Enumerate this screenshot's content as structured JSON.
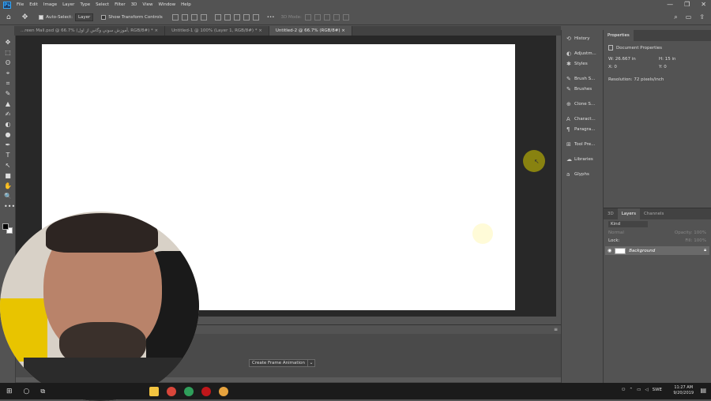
{
  "menubar": {
    "app_icon": "Ps",
    "items": [
      "File",
      "Edit",
      "Image",
      "Layer",
      "Type",
      "Select",
      "Filter",
      "3D",
      "View",
      "Window",
      "Help"
    ],
    "window_controls": [
      "—",
      "❐",
      "✕"
    ]
  },
  "options": {
    "move_tool": "✥",
    "auto_select_label": "Auto-Select:",
    "auto_select_value": "Layer",
    "show_transform_label": "Show Transform Controls",
    "mode_label": "3D Mode:",
    "more": "•••"
  },
  "tabs": [
    {
      "label": "...reen Mall.psd @ 66.7% (آموزش سوني وگاس از اول, RGB/8#) *",
      "close": "×"
    },
    {
      "label": "Untitled-1 @ 100% (Layer 1, RGB/8#) *",
      "close": "×"
    },
    {
      "label": "Untitled-2 @ 66.7% (RGB/8#)",
      "close": "×"
    }
  ],
  "tools": [
    "✥",
    "⬚",
    "ʘ",
    "⌖",
    "⌗",
    "✎",
    "▲",
    "✍",
    "◐",
    "●",
    "✒",
    "T",
    "↖",
    "■",
    "✋",
    "🔍",
    "•••"
  ],
  "timeline": {
    "create_frame": "Create Frame Animation",
    "dropdown": "⌄"
  },
  "dock": [
    {
      "icon": "⟲",
      "label": "History"
    },
    {
      "icon": "◐",
      "label": "Adjustm..."
    },
    {
      "icon": "✱",
      "label": "Styles"
    },
    {
      "icon": "✎",
      "label": "Brush S..."
    },
    {
      "icon": "✎",
      "label": "Brushes"
    },
    {
      "icon": "⊕",
      "label": "Clone S..."
    },
    {
      "icon": "A",
      "label": "Charact..."
    },
    {
      "icon": "¶",
      "label": "Paragra..."
    },
    {
      "icon": "⊞",
      "label": "Tool Pre..."
    },
    {
      "icon": "☁",
      "label": "Libraries"
    },
    {
      "icon": "a",
      "label": "Glyphs"
    }
  ],
  "properties": {
    "tab": "Properties",
    "title": "Document Properties",
    "w_label": "W:",
    "w_value": "26.667 in",
    "h_label": "H:",
    "h_value": "15 in",
    "x_label": "X:",
    "x_value": "0",
    "y_label": "Y:",
    "y_value": "0",
    "resolution": "Resolution: 72 pixels/inch"
  },
  "layers": {
    "tabs": [
      "3D",
      "Layers",
      "Channels"
    ],
    "kind": "Kind",
    "blend": "Normal",
    "opacity_label": "Opacity:",
    "opacity": "100%",
    "lock_label": "Lock:",
    "fill_label": "Fill:",
    "fill": "100%",
    "layer_name": "Background"
  },
  "taskbar": {
    "lang": "SWE",
    "time": "11:27 AM",
    "date": "9/20/2019"
  }
}
